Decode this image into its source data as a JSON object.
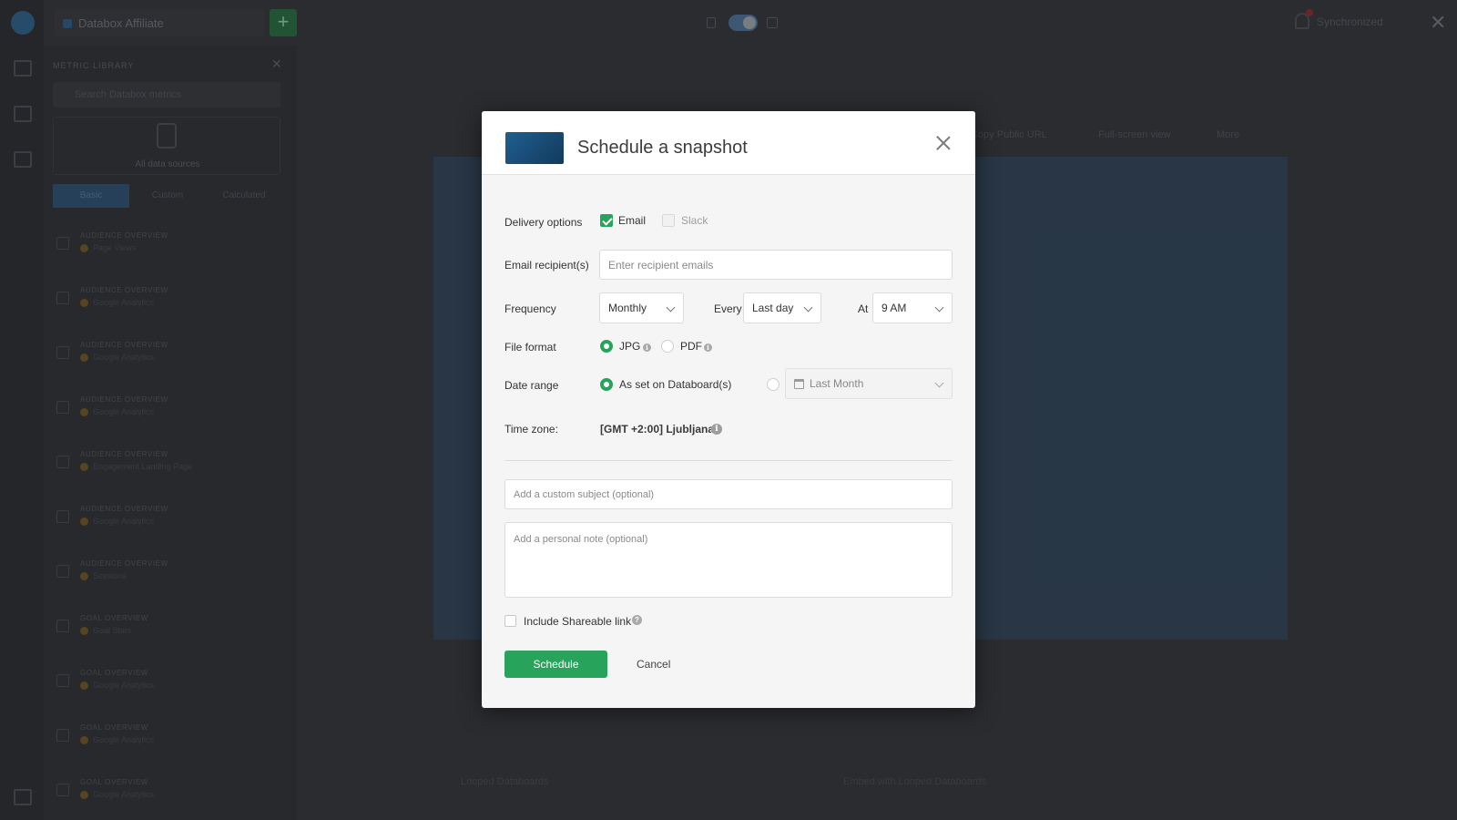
{
  "app": {
    "workspace": "Databox Affiliate",
    "sync_label": "Synchronized",
    "panel_title": "METRIC LIBRARY",
    "panel_search_placeholder": "Search Databox metrics",
    "data_sources_label": "All data sources",
    "panel_tabs": [
      {
        "label": "Basic"
      },
      {
        "label": "Custom"
      },
      {
        "label": "Calculated"
      }
    ],
    "metrics": [
      {
        "category": "AUDIENCE OVERVIEW",
        "name": "Page Views"
      },
      {
        "category": "AUDIENCE OVERVIEW",
        "name": "Google Analytics"
      },
      {
        "category": "AUDIENCE OVERVIEW",
        "name": "Google Analytics"
      },
      {
        "category": "AUDIENCE OVERVIEW",
        "name": "Google Analytics"
      },
      {
        "category": "AUDIENCE OVERVIEW",
        "name": "Engagement Landing Page"
      },
      {
        "category": "AUDIENCE OVERVIEW",
        "name": "Google Analytics"
      },
      {
        "category": "AUDIENCE OVERVIEW",
        "name": "Sessions"
      },
      {
        "category": "GOAL OVERVIEW",
        "name": "Goal Stats"
      },
      {
        "category": "GOAL OVERVIEW",
        "name": "Google Analytics"
      },
      {
        "category": "GOAL OVERVIEW",
        "name": "Google Analytics"
      },
      {
        "category": "GOAL OVERVIEW",
        "name": "Google Analytics"
      }
    ],
    "canvas_actions": {
      "copy_url": "Copy Public URL",
      "full_screen": "Full-screen view",
      "more": "More"
    },
    "bottom": {
      "looped": "Looped Databoards",
      "embed": "Embed with Looped Databoards"
    }
  },
  "modal": {
    "title": "Schedule a snapshot",
    "delivery": {
      "label": "Delivery options",
      "email": "Email",
      "email_checked": true,
      "slack": "Slack",
      "slack_checked": false
    },
    "recipients": {
      "label": "Email recipient(s)",
      "placeholder": "Enter recipient emails"
    },
    "frequency": {
      "label": "Frequency",
      "value": "Monthly",
      "every_label": "Every",
      "every_value": "Last day",
      "at_label": "At",
      "at_value": "9 AM"
    },
    "file_format": {
      "label": "File format",
      "jpg": "JPG",
      "pdf": "PDF",
      "selected": "JPG"
    },
    "date_range": {
      "label": "Date range",
      "option_databoard": "As set on Databoard(s)",
      "custom_value": "Last Month",
      "selected": "databoard"
    },
    "timezone": {
      "label": "Time zone:",
      "value": "[GMT +2:00] Ljubljana"
    },
    "subject_placeholder": "Add a custom subject (optional)",
    "note_placeholder": "Add a personal note (optional)",
    "shareable_link": {
      "label": "Include Shareable link",
      "checked": false
    },
    "buttons": {
      "schedule": "Schedule",
      "cancel": "Cancel"
    },
    "colors": {
      "accent": "#27a35b",
      "thumb": "#1a4e79"
    }
  }
}
